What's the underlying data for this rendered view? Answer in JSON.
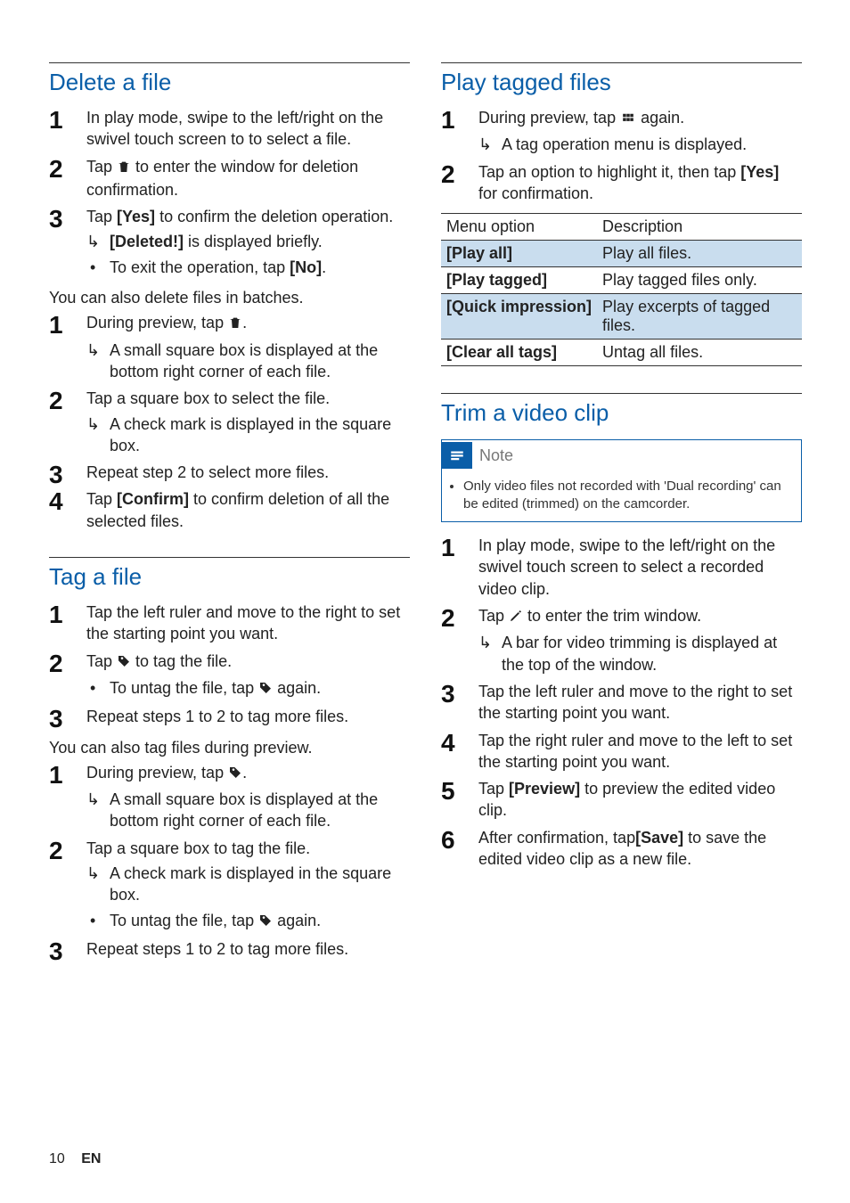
{
  "footer": {
    "page": "10",
    "lang": "EN"
  },
  "icons": {
    "trash": "trash-icon",
    "tag": "tag-icon",
    "grid": "grid-icon",
    "note": "note-icon"
  },
  "left": {
    "sec1": {
      "title": "Delete a file",
      "s1": "In play mode, swipe to the left/right on the swivel touch screen to to select a file.",
      "s2a": "Tap ",
      "s2b": " to enter the window for deletion confirmation.",
      "s3a": "Tap ",
      "s3yes": "[Yes]",
      "s3b": " to confirm the deletion operation.",
      "s3r1a": "[Deleted!]",
      "s3r1b": " is displayed briefly.",
      "s3r2a": "To exit the operation, tap ",
      "s3r2b": "[No]",
      "s3r2c": ".",
      "interA": "You can also delete files in batches.",
      "b1a": "During preview, tap ",
      "b1b": ".",
      "b1r": "A small square box is displayed at the bottom right corner of each file.",
      "b2": "Tap a square box to select the file.",
      "b2r": "A check mark is displayed in the square box.",
      "b3": "Repeat step 2 to select more files.",
      "b4a": "Tap ",
      "b4b": "[Confirm]",
      "b4c": " to confirm deletion of all the selected files."
    },
    "sec2": {
      "title": "Tag a file",
      "s1": "Tap the left ruler and move to the right to set the starting point you want.",
      "s2a": "Tap ",
      "s2b": " to tag the file.",
      "s2ra": "To untag the file, tap ",
      "s2rb": " again.",
      "s3": "Repeat steps 1 to 2 to tag more files.",
      "interA": "You can also tag files during preview.",
      "p1a": "During preview, tap ",
      "p1b": ".",
      "p1r": "A small square box is displayed at the bottom right corner of each file.",
      "p2": "Tap a square box to tag the file.",
      "p2r1": "A check mark is displayed in the square box.",
      "p2r2a": "To untag the file, tap ",
      "p2r2b": " again.",
      "p3": "Repeat steps 1 to 2 to tag more files."
    }
  },
  "right": {
    "sec1": {
      "title": "Play tagged files",
      "s1a": "During preview, tap ",
      "s1b": " again.",
      "s1r": "A tag operation menu is displayed.",
      "s2a": "Tap an option to highlight it, then tap ",
      "s2b": "[Yes]",
      "s2c": " for confirmation.",
      "table": {
        "h1": "Menu option",
        "h2": "Description",
        "rows": [
          {
            "opt": "[Play all]",
            "desc": "Play all files.",
            "hl": true
          },
          {
            "opt": "[Play tagged]",
            "desc": "Play tagged files only.",
            "hl": false
          },
          {
            "opt": "[Quick impression]",
            "desc": "Play excerpts of tagged files.",
            "hl": true
          },
          {
            "opt": "[Clear all tags]",
            "desc": "Untag all files.",
            "hl": false
          }
        ]
      }
    },
    "sec2": {
      "title": "Trim a video clip",
      "noteLabel": "Note",
      "noteText": "Only video files not recorded with 'Dual recording' can be edited (trimmed) on the camcorder.",
      "s1": "In play mode, swipe to the left/right on the swivel touch screen to select a recorded video clip.",
      "s2a": "Tap ",
      "s2b": " to enter the trim window.",
      "s2r": "A bar for video trimming is displayed at the top of the window.",
      "s3": "Tap the left ruler and move to the right to set the starting point you want.",
      "s4": "Tap the right ruler and move to the left to set the starting point you want.",
      "s5a": "Tap ",
      "s5b": "[Preview]",
      "s5c": " to preview the edited video clip.",
      "s6a": "After confirmation, tap",
      "s6b": "[Save]",
      "s6c": " to save the edited video clip as a new file."
    }
  }
}
